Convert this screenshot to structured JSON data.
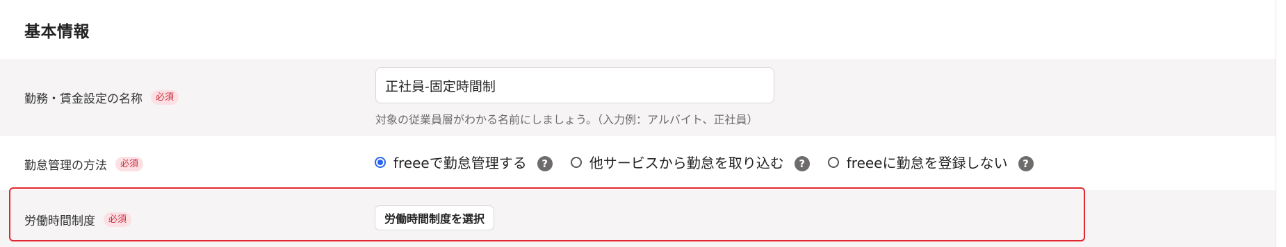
{
  "section": {
    "title": "基本情報"
  },
  "name_row": {
    "label": "勤務・賃金設定の名称",
    "required": "必須",
    "input_value": "正社員-固定時間制",
    "hint": "対象の従業員層がわかる名前にしましょう。（入力例：アルバイト、正社員）"
  },
  "attendance_row": {
    "label": "勤怠管理の方法",
    "required": "必須",
    "options": [
      {
        "label": "freeeで勤怠管理する",
        "selected": true,
        "icon": "question-icon"
      },
      {
        "label": "他サービスから勤怠を取り込む",
        "selected": false,
        "icon": "question-icon"
      },
      {
        "label": "freeeに勤怠を登録しない",
        "selected": false,
        "icon": "question-icon"
      }
    ],
    "help_glyph": "?"
  },
  "labor_row": {
    "label": "労働時間制度",
    "required": "必須",
    "button_label": "労働時間制度を選択"
  },
  "colors": {
    "accent": "#2864f0",
    "required_badge_bg": "#fce0e3",
    "required_badge_text": "#c52f3f",
    "highlight": "#e0262e",
    "row_shade": "#f6f4f4"
  }
}
